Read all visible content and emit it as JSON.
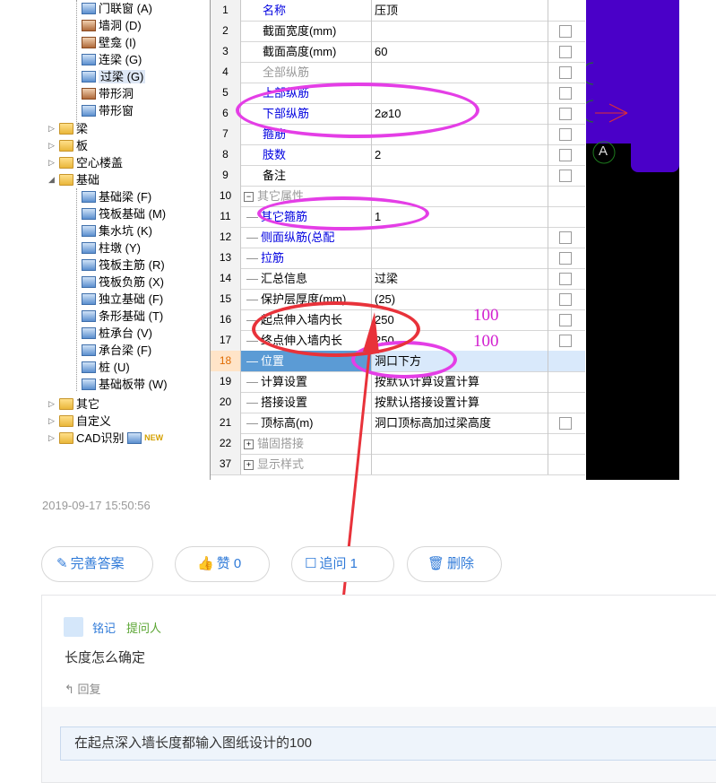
{
  "tree": {
    "items": [
      {
        "label": "门联窗 (A)",
        "icon": "door-window-icon"
      },
      {
        "label": "墙洞 (D)",
        "icon": "wall-hole-icon"
      },
      {
        "label": "壁龛 (I)",
        "icon": "niche-icon"
      },
      {
        "label": "连梁 (G)",
        "icon": "link-beam-icon"
      },
      {
        "label": "过梁 (G)",
        "icon": "lintel-icon"
      },
      {
        "label": "带形洞",
        "icon": "strip-hole-icon"
      },
      {
        "label": "带形窗",
        "icon": "strip-window-icon"
      },
      {
        "label": "梁",
        "icon": "folder-icon"
      },
      {
        "label": "板",
        "icon": "folder-icon"
      },
      {
        "label": "空心楼盖",
        "icon": "folder-icon"
      },
      {
        "label": "基础",
        "icon": "folder-open-icon"
      },
      {
        "label": "基础梁 (F)",
        "icon": "foundation-beam-icon"
      },
      {
        "label": "筏板基础 (M)",
        "icon": "raft-icon"
      },
      {
        "label": "集水坑 (K)",
        "icon": "sump-icon"
      },
      {
        "label": "柱墩 (Y)",
        "icon": "pier-icon"
      },
      {
        "label": "筏板主筋 (R)",
        "icon": "raft-main-rebar-icon"
      },
      {
        "label": "筏板负筋 (X)",
        "icon": "raft-neg-rebar-icon"
      },
      {
        "label": "独立基础 (F)",
        "icon": "isolated-footing-icon"
      },
      {
        "label": "条形基础 (T)",
        "icon": "strip-footing-icon"
      },
      {
        "label": "桩承台 (V)",
        "icon": "pile-cap-icon"
      },
      {
        "label": "承台梁 (F)",
        "icon": "cap-beam-icon"
      },
      {
        "label": "桩 (U)",
        "icon": "pile-icon"
      },
      {
        "label": "基础板带 (W)",
        "icon": "foundation-strip-icon"
      },
      {
        "label": "其它",
        "icon": "folder-icon"
      },
      {
        "label": "自定义",
        "icon": "folder-icon"
      },
      {
        "label": "CAD识别",
        "icon": "folder-icon",
        "badge": "NEW"
      }
    ]
  },
  "grid": {
    "rows": [
      {
        "num": "1",
        "name": "名称",
        "value": "压顶",
        "check": false
      },
      {
        "num": "2",
        "name": "截面宽度(mm)",
        "value": "",
        "check": true
      },
      {
        "num": "3",
        "name": "截面高度(mm)",
        "value": "60",
        "check": true
      },
      {
        "num": "4",
        "name": "全部纵筋",
        "value": "",
        "check": true
      },
      {
        "num": "5",
        "name": "上部纵筋",
        "value": "",
        "check": true
      },
      {
        "num": "6",
        "name": "下部纵筋",
        "value": "2⌀10",
        "check": true
      },
      {
        "num": "7",
        "name": "箍筋",
        "value": "",
        "check": true
      },
      {
        "num": "8",
        "name": "肢数",
        "value": "2",
        "check": true
      },
      {
        "num": "9",
        "name": "备注",
        "value": "",
        "check": true
      },
      {
        "num": "10",
        "name": "其它属性",
        "value": "",
        "check": false
      },
      {
        "num": "11",
        "name": "其它箍筋",
        "value": "1",
        "check": false
      },
      {
        "num": "12",
        "name": "侧面纵筋(总配",
        "value": "",
        "check": true
      },
      {
        "num": "13",
        "name": "拉筋",
        "value": "",
        "check": true
      },
      {
        "num": "14",
        "name": "汇总信息",
        "value": "过梁",
        "check": true
      },
      {
        "num": "15",
        "name": "保护层厚度(mm)",
        "value": "(25)",
        "check": true
      },
      {
        "num": "16",
        "name": "起点伸入墙内长",
        "value": "250",
        "check": true
      },
      {
        "num": "17",
        "name": "终点伸入墙内长",
        "value": "250",
        "check": true
      },
      {
        "num": "18",
        "name": "位置",
        "value": "洞口下方",
        "check": false
      },
      {
        "num": "19",
        "name": "计算设置",
        "value": "按默认计算设置计算",
        "check": false
      },
      {
        "num": "20",
        "name": "搭接设置",
        "value": "按默认搭接设置计算",
        "check": false
      },
      {
        "num": "21",
        "name": "顶标高(m)",
        "value": "洞口顶标高加过梁高度",
        "check": true
      },
      {
        "num": "22",
        "name": "锚固搭接",
        "value": "",
        "check": false
      },
      {
        "num": "37",
        "name": "显示样式",
        "value": "",
        "check": false
      }
    ]
  },
  "annotations": {
    "a1": "100",
    "a2": "100",
    "axis_label": "A"
  },
  "post": {
    "timestamp": "2019-09-17 15:50:56",
    "actions": {
      "improve": "完善答案",
      "like": "赞 0",
      "followup": "追问 1",
      "delete": "删除"
    }
  },
  "comment": {
    "user": "铭记",
    "role": "提问人",
    "question": "长度怎么确定",
    "reply_label": "回复",
    "answer": "在起点深入墙长度都输入图纸设计的100"
  },
  "colors": {
    "accent": "#2f7ad8",
    "annotation": "#e43ee6",
    "arrow": "#e8323a",
    "cad_purple": "#4a00c8"
  }
}
